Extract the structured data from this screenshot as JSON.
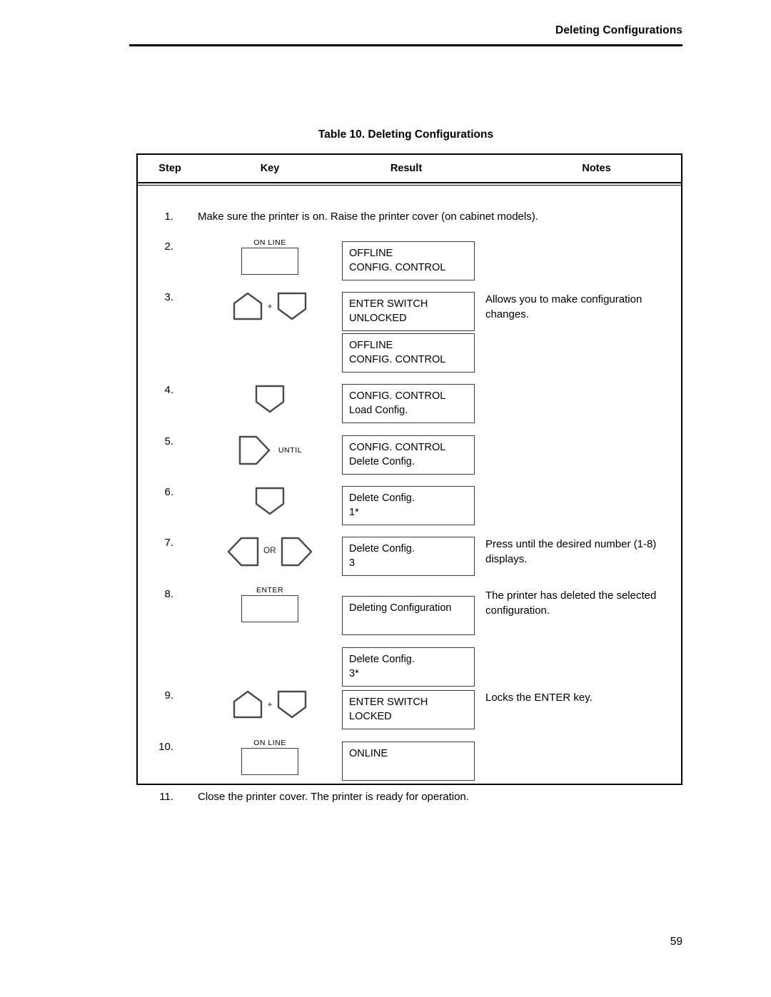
{
  "header": {
    "running_head": "Deleting Configurations"
  },
  "table": {
    "caption": "Table 10. Deleting Configurations",
    "columns": {
      "step": "Step",
      "key": "Key",
      "result": "Result",
      "notes": "Notes"
    },
    "rows": [
      {
        "step": "1.",
        "full_text": "Make sure the printer is on. Raise the printer cover (on cabinet models).",
        "key": null,
        "result": null,
        "notes": ""
      },
      {
        "step": "2.",
        "key": {
          "type": "rect",
          "label": "ON LINE"
        },
        "result": {
          "line1": "OFFLINE",
          "line2": "CONFIG. CONTROL"
        },
        "notes": ""
      },
      {
        "step": "3.",
        "key": {
          "type": "combo",
          "first": "up-arrow",
          "connector": "+",
          "second": "down-arrow"
        },
        "result": {
          "line1": "ENTER SWITCH",
          "line2": "UNLOCKED"
        },
        "result2": {
          "line1": "OFFLINE",
          "line2": "CONFIG. CONTROL"
        },
        "notes": "Allows you to make configuration changes."
      },
      {
        "step": "4.",
        "key": {
          "type": "single",
          "shape": "down-arrow"
        },
        "result": {
          "line1": "CONFIG. CONTROL",
          "line2": "Load Config."
        },
        "notes": ""
      },
      {
        "step": "5.",
        "key": {
          "type": "single",
          "shape": "right-arrow",
          "label": "UNTIL"
        },
        "result": {
          "line1": "CONFIG. CONTROL",
          "line2": "Delete Config."
        },
        "notes": ""
      },
      {
        "step": "6.",
        "key": {
          "type": "single",
          "shape": "down-arrow"
        },
        "result": {
          "line1": "Delete Config.",
          "line2": "1*"
        },
        "notes": ""
      },
      {
        "step": "7.",
        "key": {
          "type": "combo",
          "first": "left-arrow",
          "connector": "OR",
          "second": "right-arrow"
        },
        "result": {
          "line1": "Delete Config.",
          "line2": "3"
        },
        "notes": "Press until the desired number (1-8) displays."
      },
      {
        "step": "8.",
        "key": {
          "type": "rect",
          "label": "ENTER"
        },
        "result": {
          "line1": "Deleting Configuration",
          "line2": ""
        },
        "result2": {
          "line1": "Delete Config.",
          "line2": "3*"
        },
        "notes": "The printer has deleted the selected configuration."
      },
      {
        "step": "9.",
        "key": {
          "type": "combo",
          "first": "up-arrow",
          "connector": "+",
          "second": "down-arrow"
        },
        "result": {
          "line1": "ENTER SWITCH",
          "line2": "LOCKED"
        },
        "notes": "Locks the ENTER key."
      },
      {
        "step": "10.",
        "key": {
          "type": "rect",
          "label": "ON LINE"
        },
        "result": {
          "line1": "ONLINE",
          "line2": ""
        },
        "notes": ""
      },
      {
        "step": "11.",
        "full_text": "Close the printer cover. The printer is ready for operation.",
        "key": null,
        "result": null,
        "notes": ""
      }
    ]
  },
  "footer": {
    "page_number": "59"
  }
}
